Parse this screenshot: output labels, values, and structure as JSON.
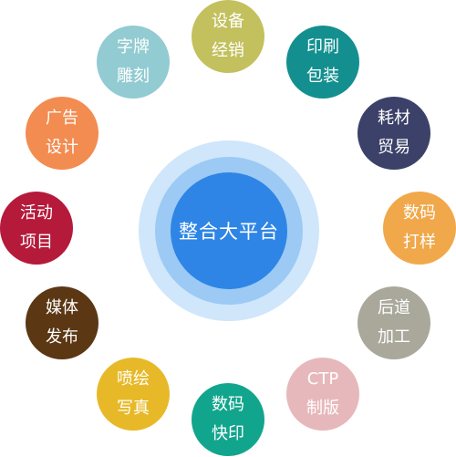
{
  "center": {
    "label": "整合大平台"
  },
  "nodes": [
    {
      "line1": "设备",
      "line2": "经销",
      "color": "#c3c05e"
    },
    {
      "line1": "印刷",
      "line2": "包装",
      "color": "#148f8f"
    },
    {
      "line1": "耗材",
      "line2": "贸易",
      "color": "#3b4168"
    },
    {
      "line1": "数码",
      "line2": "打样",
      "color": "#f0a84b"
    },
    {
      "line1": "后道",
      "line2": "加工",
      "color": "#a9a89b"
    },
    {
      "line1": "CTP",
      "line2": "制版",
      "color": "#e7b8bb"
    },
    {
      "line1": "数码",
      "line2": "快印",
      "color": "#12a58d"
    },
    {
      "line1": "喷绘",
      "line2": "写真",
      "color": "#e7b928"
    },
    {
      "line1": "媒体",
      "line2": "发布",
      "color": "#5b3714"
    },
    {
      "line1": "活动",
      "line2": "项目",
      "color": "#b51a3a"
    },
    {
      "line1": "广告",
      "line2": "设计",
      "color": "#f28c50"
    },
    {
      "line1": "字牌",
      "line2": "雕刻",
      "color": "#92cbd2"
    }
  ]
}
